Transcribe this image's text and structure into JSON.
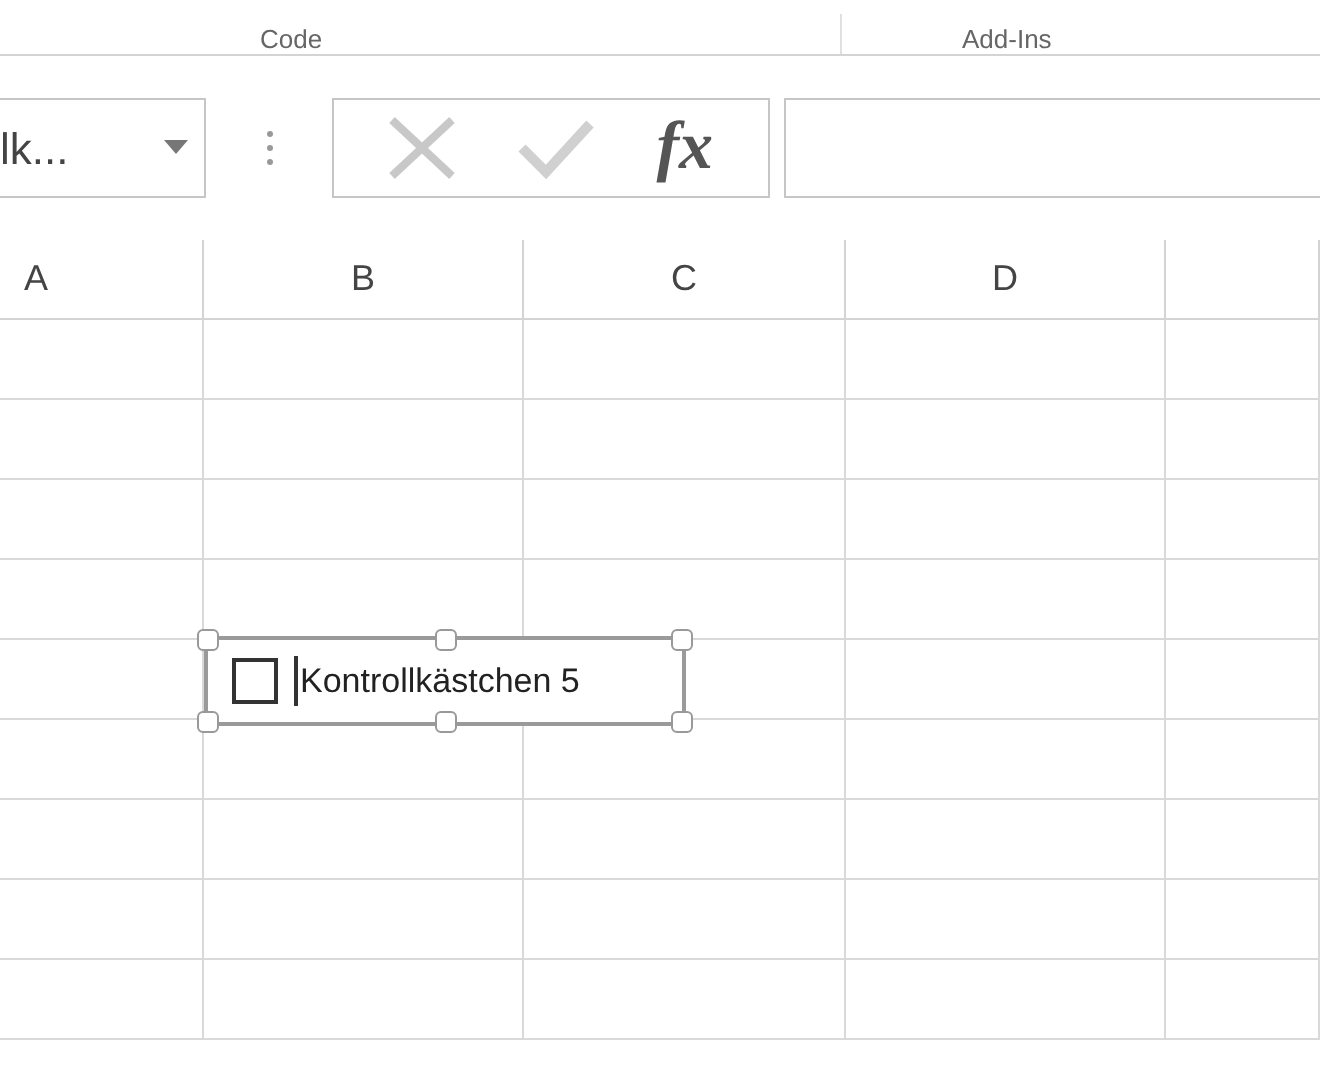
{
  "ribbon_groups": [
    "Code",
    "Add-Ins"
  ],
  "name_box": {
    "value": "lk..."
  },
  "formula_bar": {
    "buttons": [
      {
        "kind": "cancel"
      },
      {
        "kind": "enter"
      },
      {
        "kind": "function",
        "label": "fx"
      }
    ]
  },
  "columns": [
    "A",
    "B",
    "C",
    "D"
  ],
  "form_control": {
    "label": "Kontrollkästchen 5",
    "checked": false,
    "selected": true
  }
}
